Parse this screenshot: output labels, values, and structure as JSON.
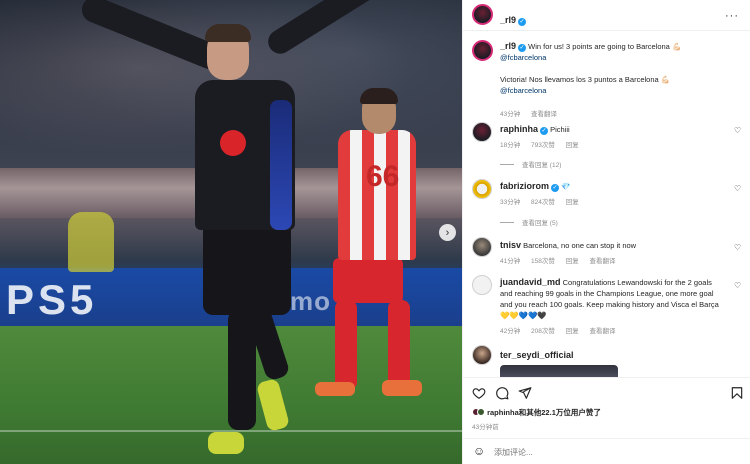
{
  "photo": {
    "board_text_1": "PS5",
    "board_text_2": "mo",
    "next_icon": "chevron-right-icon"
  },
  "post": {
    "author": "_rl9",
    "caption_en": "Win for us! 3 points are going to Barcelona 💪🏻",
    "caption_mention": "@fcbarcelona",
    "caption_es": "Victoria! Nos llevamos los 3 puntos a Barcelona 💪🏻",
    "caption_mention_2": "@fcbarcelona",
    "caption_time": "43分钟",
    "caption_translate": "查看翻译"
  },
  "comments": [
    {
      "user": "raphinha",
      "verified": true,
      "text": "Pichiii",
      "time": "18分钟",
      "likes": "793次赞",
      "reply": "回复",
      "replies": "查看回复 (12)"
    },
    {
      "user": "fabriziorom",
      "verified": true,
      "text": "💎",
      "time": "33分钟",
      "likes": "824次赞",
      "reply": "回复",
      "replies": "查看回复 (5)"
    },
    {
      "user": "tnisv",
      "verified": false,
      "text": "Barcelona, no one can stop it now",
      "time": "41分钟",
      "likes": "158次赞",
      "reply": "回复",
      "translate": "查看翻译"
    },
    {
      "user": "juandavid_md",
      "verified": false,
      "text": "Congratulations Lewandowski for the 2 goals and reaching 99 goals in the Champions League, one more goal and you reach 100 goals. Keep making history and Visca el Barça 💛💛💙💙🖤",
      "time": "42分钟",
      "likes": "208次赞",
      "reply": "回复",
      "translate": "查看翻译"
    },
    {
      "user": "ter_seydi_official",
      "verified": false,
      "text": ""
    }
  ],
  "footer": {
    "likes_text": "raphinha和其他22.1万位用户赞了",
    "time": "43分钟前",
    "comment_placeholder": "添加评论..."
  },
  "colors": {
    "verified": "#1d9bf0",
    "link": "#00376b",
    "meta": "#8e8e8e"
  }
}
